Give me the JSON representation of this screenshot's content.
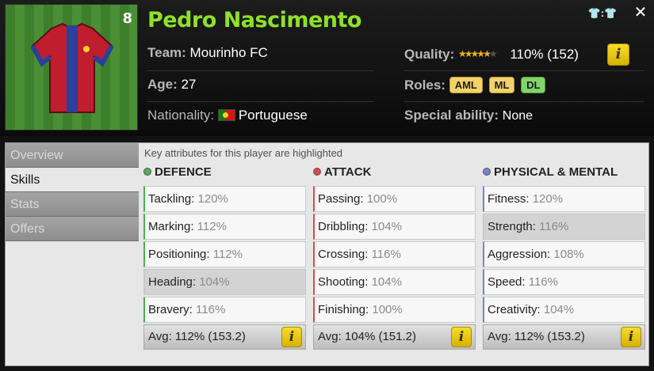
{
  "player": {
    "name": "Pedro Nascimento",
    "number": "8",
    "team_label": "Team:",
    "team": "Mourinho FC",
    "age_label": "Age:",
    "age": "27",
    "nationality_label": "Nationality:",
    "nationality": "Portuguese",
    "quality_label": "Quality:",
    "quality_value": "110% (152)",
    "quality_stars": 4.5,
    "roles_label": "Roles:",
    "roles": [
      "AML",
      "ML",
      "DL"
    ],
    "special_label": "Special ability:",
    "special": "None"
  },
  "colors": {
    "name": "#8ee02a",
    "defence": "#4caf50",
    "attack": "#e04848",
    "physical": "#7b7fd6"
  },
  "tabs": [
    "Overview",
    "Skills",
    "Stats",
    "Offers"
  ],
  "active_tab": "Skills",
  "hint": "Key attributes for this player are highlighted",
  "columns": [
    {
      "title": "DEFENCE",
      "rows": [
        {
          "label": "Tackling:",
          "value": "120%"
        },
        {
          "label": "Marking:",
          "value": "112%"
        },
        {
          "label": "Positioning:",
          "value": "112%"
        },
        {
          "label": "Heading:",
          "value": "104%"
        },
        {
          "label": "Bravery:",
          "value": "116%"
        }
      ],
      "avg": "Avg: 112% (153.2)"
    },
    {
      "title": "ATTACK",
      "rows": [
        {
          "label": "Passing:",
          "value": "100%"
        },
        {
          "label": "Dribbling:",
          "value": "104%"
        },
        {
          "label": "Crossing:",
          "value": "116%"
        },
        {
          "label": "Shooting:",
          "value": "104%"
        },
        {
          "label": "Finishing:",
          "value": "100%"
        }
      ],
      "avg": "Avg: 104% (151.2)"
    },
    {
      "title": "PHYSICAL & MENTAL",
      "rows": [
        {
          "label": "Fitness:",
          "value": "120%"
        },
        {
          "label": "Strength:",
          "value": "116%"
        },
        {
          "label": "Aggression:",
          "value": "108%"
        },
        {
          "label": "Speed:",
          "value": "116%"
        },
        {
          "label": "Creativity:",
          "value": "104%"
        }
      ],
      "avg": "Avg: 112% (153.2)"
    }
  ]
}
